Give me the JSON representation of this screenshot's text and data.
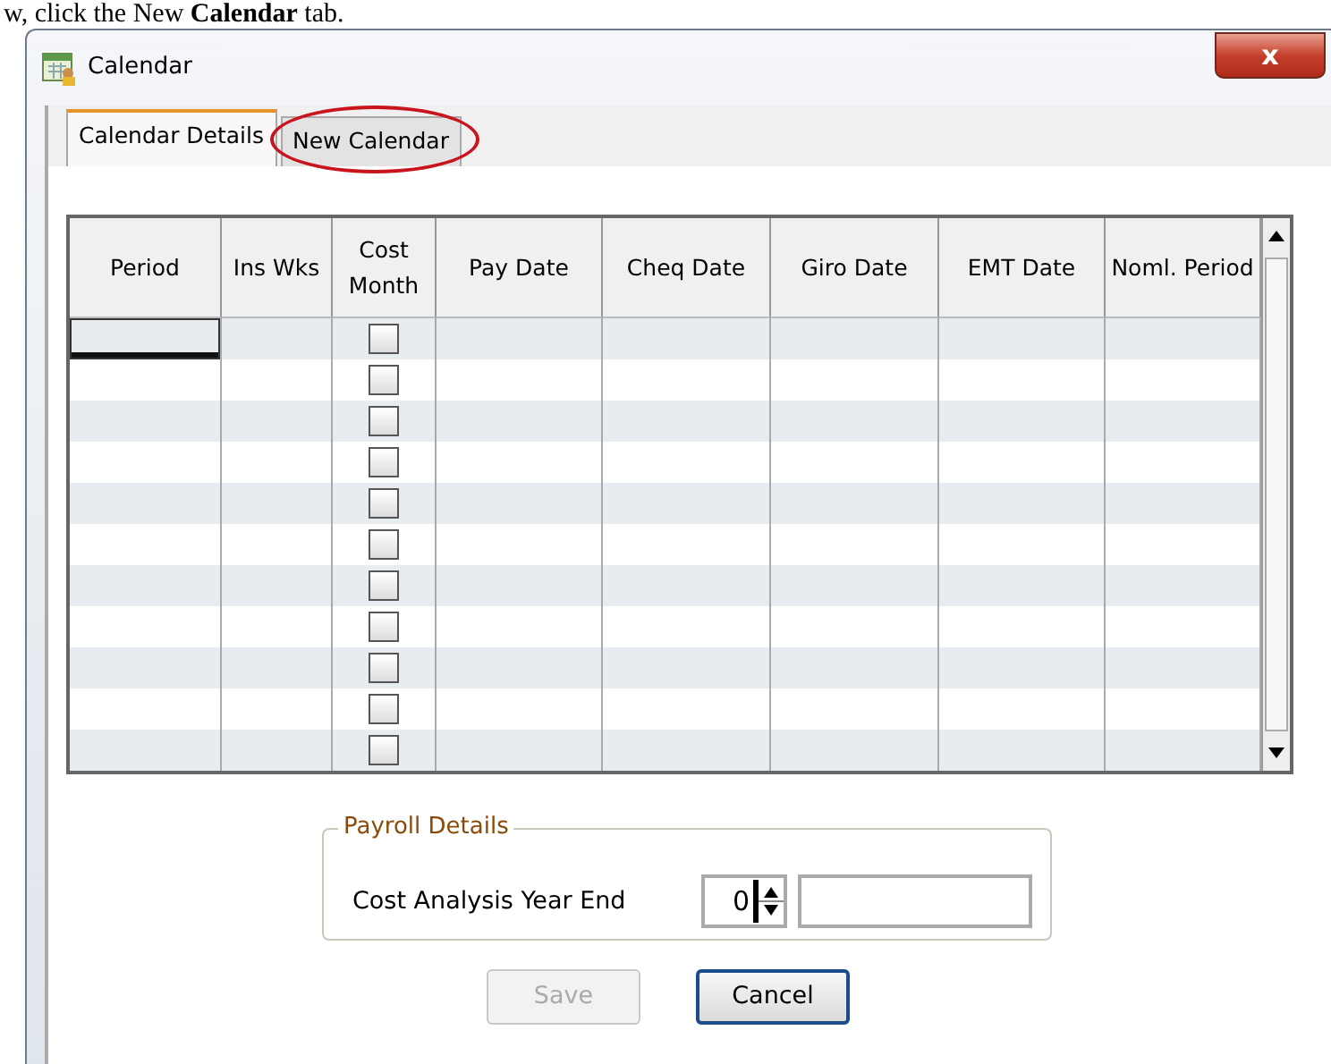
{
  "caption": "w, click the New **Calendar** tab.",
  "window": {
    "title": "Calendar",
    "close": "x"
  },
  "tabs": [
    {
      "label": "Calendar Details",
      "selected": true,
      "annotated": false
    },
    {
      "label": "New Calendar",
      "selected": false,
      "annotated": true
    }
  ],
  "table": {
    "columns": [
      "Period",
      "Ins Wks",
      "Cost Month",
      "Pay Date",
      "Cheq Date",
      "Giro Date",
      "EMT Date",
      "Noml. Period"
    ],
    "rows": [
      {
        "checked": false,
        "focused": true
      },
      {
        "checked": false,
        "focused": false
      },
      {
        "checked": false,
        "focused": false
      },
      {
        "checked": false,
        "focused": false
      },
      {
        "checked": false,
        "focused": false
      },
      {
        "checked": false,
        "focused": false
      },
      {
        "checked": false,
        "focused": false
      },
      {
        "checked": false,
        "focused": false
      },
      {
        "checked": false,
        "focused": false
      },
      {
        "checked": false,
        "focused": false
      },
      {
        "checked": false,
        "focused": false
      }
    ]
  },
  "payroll": {
    "legend": "Payroll Details",
    "label": "Cost Analysis Year End",
    "spin_value": "0"
  },
  "buttons": [
    {
      "label": "Save",
      "disabled": true
    },
    {
      "label": "Cancel",
      "disabled": false
    }
  ]
}
